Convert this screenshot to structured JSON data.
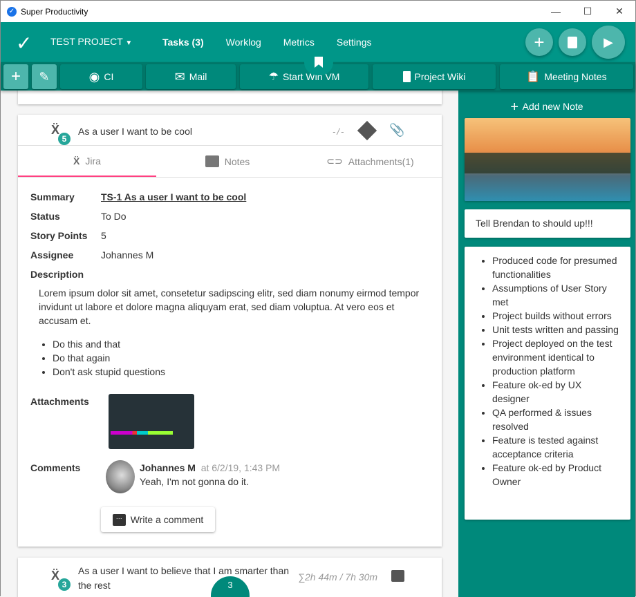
{
  "window": {
    "title": "Super Productivity",
    "min": "—",
    "max": "☐",
    "close": "✕"
  },
  "header": {
    "project": "TEST PROJECT",
    "nav": [
      "Tasks (3)",
      "Worklog",
      "Metrics",
      "Settings"
    ]
  },
  "toolbar": {
    "buttons": [
      "CI",
      "Mail",
      "Start Win VM",
      "Project Wiki",
      "Meeting Notes"
    ]
  },
  "task_main": {
    "title": "As a user I want to be cool",
    "badge": "5",
    "estimate": "-/-",
    "tabs": [
      "Jira",
      "Notes",
      "Attachments(1)"
    ],
    "fields": {
      "summary_label": "Summary",
      "summary": "TS-1 As a user I want to be cool",
      "status_label": "Status",
      "status": "To Do",
      "points_label": "Story Points",
      "points": "5",
      "assignee_label": "Assignee",
      "assignee": "Johannes M",
      "description_label": "Description",
      "description": "Lorem ipsum dolor sit amet, consetetur sadipscing elitr, sed diam nonumy eirmod tempor invidunt ut labore et dolore magna aliquyam erat, sed diam voluptua. At vero eos et accusam et.",
      "bullets": [
        "Do this and that",
        "Do that again",
        "Don't ask stupid questions"
      ],
      "attachments_label": "Attachments",
      "comments_label": "Comments"
    },
    "comment": {
      "author": "Johannes M",
      "time": "at 6/2/19, 1:43 PM",
      "text": "Yeah, I'm not gonna do it."
    },
    "write_comment": "Write a comment"
  },
  "task_next": {
    "title": "As a user I want to believe that I am smarter than the rest",
    "badge": "3",
    "time": "∑2h 44m / 7h 30m"
  },
  "fab_bottom": {
    "count": "3"
  },
  "notes": {
    "add": "Add new Note",
    "note1": "Tell Brendan to should up!!!",
    "checklist": [
      "Produced code for presumed functionalities",
      "Assumptions of User Story met",
      "Project builds without errors",
      "Unit tests written and passing",
      "Project deployed on the test environment identical to production platform",
      "Feature ok-ed by UX designer",
      "QA performed & issues resolved",
      "Feature is tested against acceptance criteria",
      "Feature ok-ed by Product Owner"
    ]
  }
}
